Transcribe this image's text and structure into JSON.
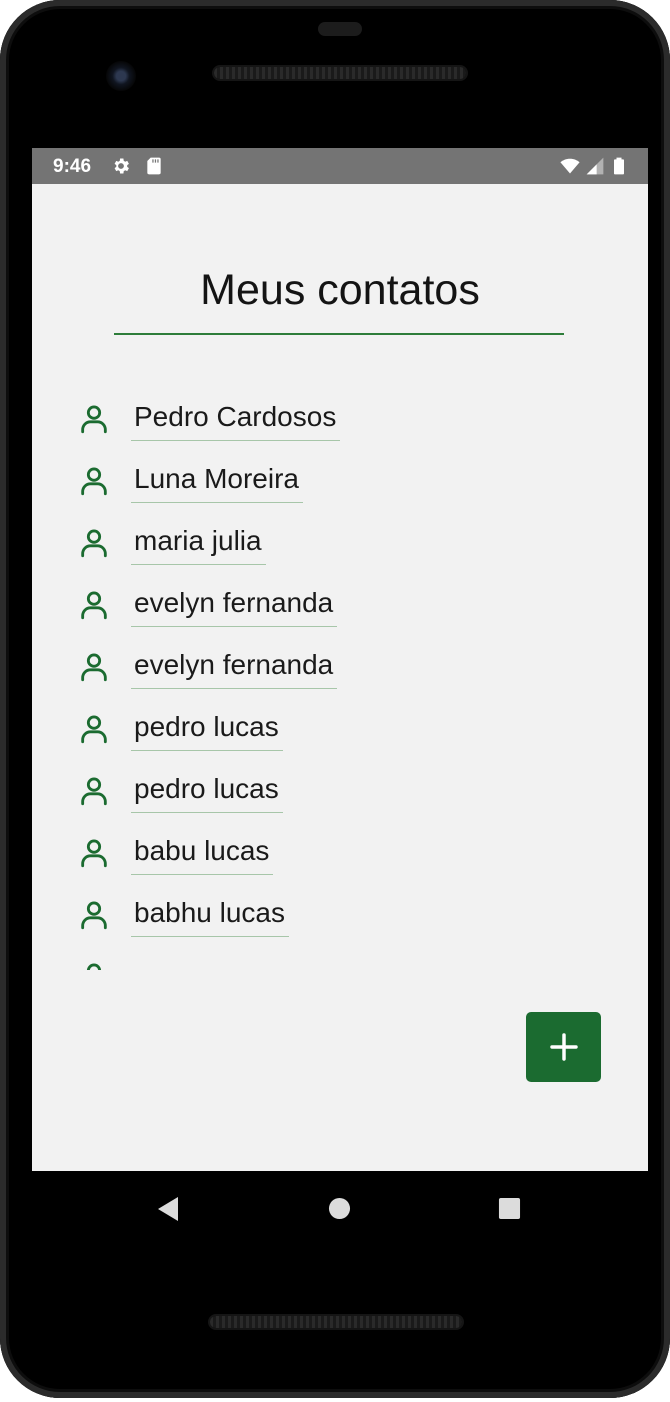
{
  "status_bar": {
    "time": "9:46"
  },
  "screen": {
    "title": "Meus contatos"
  },
  "contacts": [
    "Pedro Cardosos",
    "Luna Moreira",
    "maria julia",
    "evelyn fernanda",
    "evelyn fernanda",
    "pedro lucas",
    "pedro lucas",
    "babu lucas",
    "babhu lucas"
  ],
  "fab": {
    "icon": "plus-icon"
  },
  "colors": {
    "accent": "#1b6b30",
    "background": "#f2f2f2",
    "statusbar": "#747474"
  },
  "icons": {
    "contact": "person-outline-icon",
    "nav": [
      "back-triangle-icon",
      "home-circle-icon",
      "recents-square-icon"
    ]
  }
}
